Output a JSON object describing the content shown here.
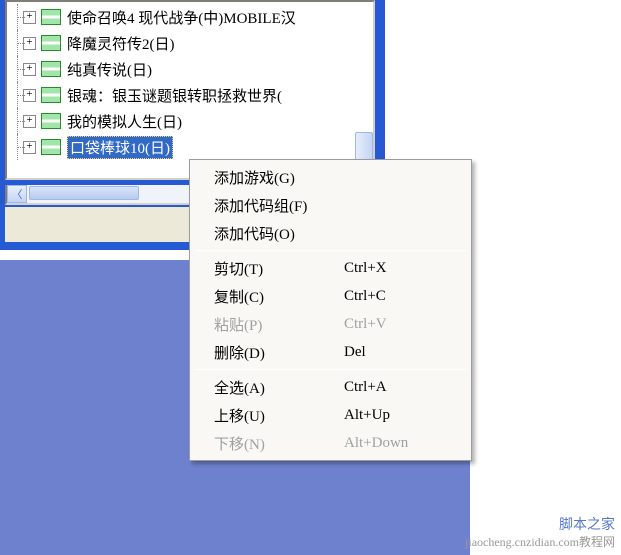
{
  "tree": {
    "items": [
      {
        "label": "使命召唤4 现代战争(中)MOBILE汉"
      },
      {
        "label": "降魔灵符传2(日)"
      },
      {
        "label": "纯真传说(日)"
      },
      {
        "label": "银魂：银玉谜题银转职拯救世界("
      },
      {
        "label": "我的模拟人生(日)"
      },
      {
        "label": "口袋棒球10(日)",
        "selected": true
      }
    ]
  },
  "menu": {
    "groups": [
      [
        {
          "label": "添加游戏(G)",
          "shortcut": "",
          "enabled": true,
          "name": "add-game"
        },
        {
          "label": "添加代码组(F)",
          "shortcut": "",
          "enabled": true,
          "name": "add-code-group"
        },
        {
          "label": "添加代码(O)",
          "shortcut": "",
          "enabled": true,
          "name": "add-code"
        }
      ],
      [
        {
          "label": "剪切(T)",
          "shortcut": "Ctrl+X",
          "enabled": true,
          "name": "cut"
        },
        {
          "label": "复制(C)",
          "shortcut": "Ctrl+C",
          "enabled": true,
          "name": "copy"
        },
        {
          "label": "粘贴(P)",
          "shortcut": "Ctrl+V",
          "enabled": false,
          "name": "paste"
        },
        {
          "label": "删除(D)",
          "shortcut": "Del",
          "enabled": true,
          "name": "delete"
        }
      ],
      [
        {
          "label": "全选(A)",
          "shortcut": "Ctrl+A",
          "enabled": true,
          "name": "select-all"
        },
        {
          "label": "上移(U)",
          "shortcut": "Alt+Up",
          "enabled": true,
          "name": "move-up"
        },
        {
          "label": "下移(N)",
          "shortcut": "Alt+Down",
          "enabled": false,
          "name": "move-down"
        }
      ]
    ]
  },
  "watermark": {
    "line1": "脚本之家",
    "line2": "jiaocheng.cnzidian.com教程网"
  }
}
